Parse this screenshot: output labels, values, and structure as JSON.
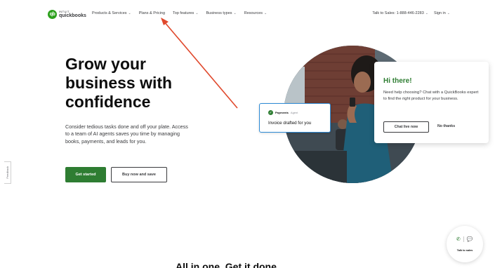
{
  "nav": {
    "logo_small": "INTUIT",
    "logo_big": "quickbooks",
    "logo_mark": "qb",
    "links": [
      {
        "label": "Products & Services"
      },
      {
        "label": "Plans & Pricing"
      },
      {
        "label": "Top features"
      },
      {
        "label": "Business types"
      },
      {
        "label": "Resources"
      }
    ],
    "sales": "Talk to Sales: 1-888-446-2283",
    "signin": "Sign in"
  },
  "hero": {
    "title": "Grow your business with confidence",
    "subtitle": "Consider tedious tasks done and off your plate. Access to a team of AI agents saves you time by managing books, payments, and leads for you.",
    "primary_cta": "Get started",
    "secondary_cta": "Buy now and save"
  },
  "feedback": "Feedback",
  "payments_card": {
    "label": "Payments",
    "agent": "Agent",
    "text": "Invoice drafted for you"
  },
  "chat_card": {
    "title": "Hi there!",
    "body": "Need help choosing? Chat with a QuickBooks expert to find the right product for your business.",
    "live_button": "Chat live now",
    "decline": "No thanks"
  },
  "talk_to_sales": "Talk to sales",
  "bottom_heading": "All in one. Get it done.",
  "colors": {
    "brand_green": "#2e7d32",
    "logo_green": "#2ca01c",
    "annotation_red": "#e0492d",
    "card_border_blue": "#2e8bd6"
  }
}
